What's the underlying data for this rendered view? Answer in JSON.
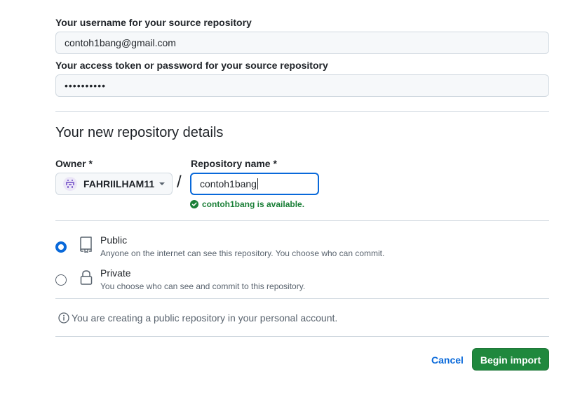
{
  "top_cut_text": "",
  "source": {
    "username_label": "Your username for your source repository",
    "username_value": "contoh1bang@gmail.com",
    "token_label": "Your access token or password for your source repository",
    "token_value": "••••••••••"
  },
  "new_repo": {
    "section_title": "Your new repository details",
    "owner_label": "Owner *",
    "owner_value": "FAHRIILHAM11",
    "slash": "/",
    "repo_name_label": "Repository name *",
    "repo_name_value": "contoh1bang",
    "availability_text": "contoh1bang is available."
  },
  "visibility": {
    "selected": "public",
    "options": [
      {
        "title": "Public",
        "description": "Anyone on the internet can see this repository. You choose who can commit.",
        "icon": "repo-icon"
      },
      {
        "title": "Private",
        "description": "You choose who can see and commit to this repository.",
        "icon": "lock-icon"
      }
    ]
  },
  "info_text": "You are creating a public repository in your personal account.",
  "actions": {
    "cancel_label": "Cancel",
    "submit_label": "Begin import"
  },
  "colors": {
    "accent": "#0969da",
    "success": "#1a7f37",
    "primary_button": "#1f883d",
    "border": "#d1d9e0",
    "muted_text": "#59636e"
  }
}
